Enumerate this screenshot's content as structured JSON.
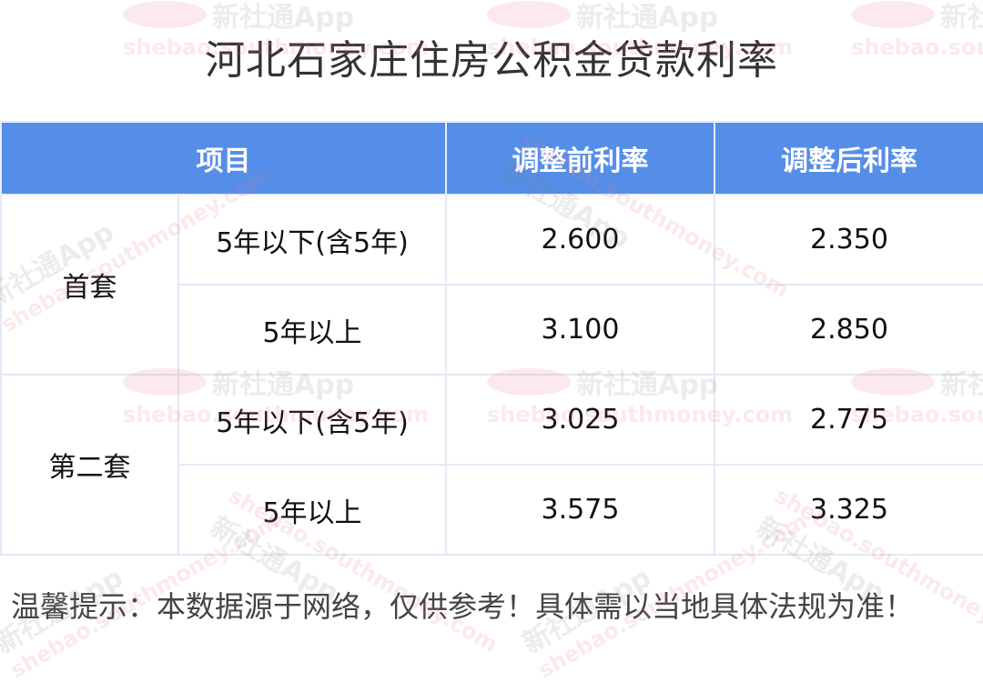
{
  "title": "河北石家庄住房公积金贷款利率",
  "table": {
    "headers": [
      "项目",
      "调整前利率",
      "调整后利率"
    ],
    "groups": [
      {
        "name": "首套",
        "rows": [
          {
            "term": "5年以下(含5年)",
            "before": "2.600",
            "after": "2.350"
          },
          {
            "term": "5年以上",
            "before": "3.100",
            "after": "2.850"
          }
        ]
      },
      {
        "name": "第二套",
        "rows": [
          {
            "term": "5年以下(含5年)",
            "before": "3.025",
            "after": "2.775"
          },
          {
            "term": "5年以上",
            "before": "3.575",
            "after": "3.325"
          }
        ]
      }
    ]
  },
  "notice": "温馨提示：本数据源于网络，仅供参考！具体需以当地具体法规为准！",
  "watermark": {
    "brand": "新社通App",
    "url": "shebao.southmoney.com",
    "logo_icon": "sb-logo-icon"
  },
  "colors": {
    "header_bg": "#558ee8",
    "adjusted_rate": "#4f8ae6",
    "watermark": "#e8788c"
  }
}
